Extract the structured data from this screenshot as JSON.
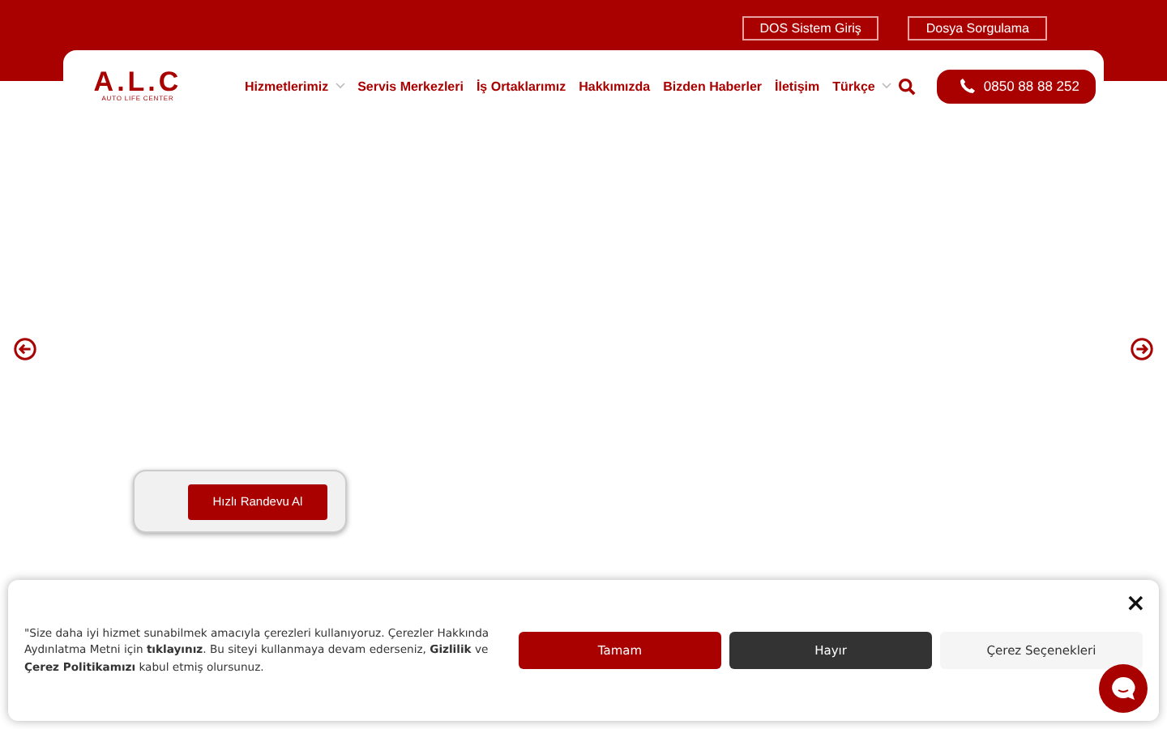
{
  "top_links": [
    "DOS Sistem Giriş",
    "Dosya Sorgulama"
  ],
  "logo": {
    "title": "A.L.C",
    "subtitle": "AUTO LIFE CENTER"
  },
  "nav": [
    {
      "label": "Hizmetlerimiz",
      "dropdown": true
    },
    {
      "label": "Servis Merkezleri",
      "dropdown": false
    },
    {
      "label": "İş Ortaklarımız",
      "dropdown": false
    },
    {
      "label": "Hakkımızda",
      "dropdown": false
    },
    {
      "label": "Bizden Haberler",
      "dropdown": false
    },
    {
      "label": "İletişim",
      "dropdown": false
    },
    {
      "label": "Türkçe",
      "dropdown": true
    }
  ],
  "phone": "0850 88 88 252",
  "appointment_button": "Hızlı Randevu Al",
  "cookie": {
    "text": "\"Size daha iyi hizmet sunabilmek amacıyla çerezleri kullanıyoruz. Çerezler Hakkında Aydınlatma Metni için **tıklayınız**. Bu siteyi kullanmaya devam ederseniz, **Gizlilik** ve **Çerez Politikamızı** kabul etmiş olursunuz.",
    "buttons": [
      {
        "label": "Tamam",
        "kind": "accept"
      },
      {
        "label": "Hayır",
        "kind": "deny"
      },
      {
        "label": "Çerez Seçenekleri",
        "kind": "options"
      }
    ],
    "close": "×"
  }
}
